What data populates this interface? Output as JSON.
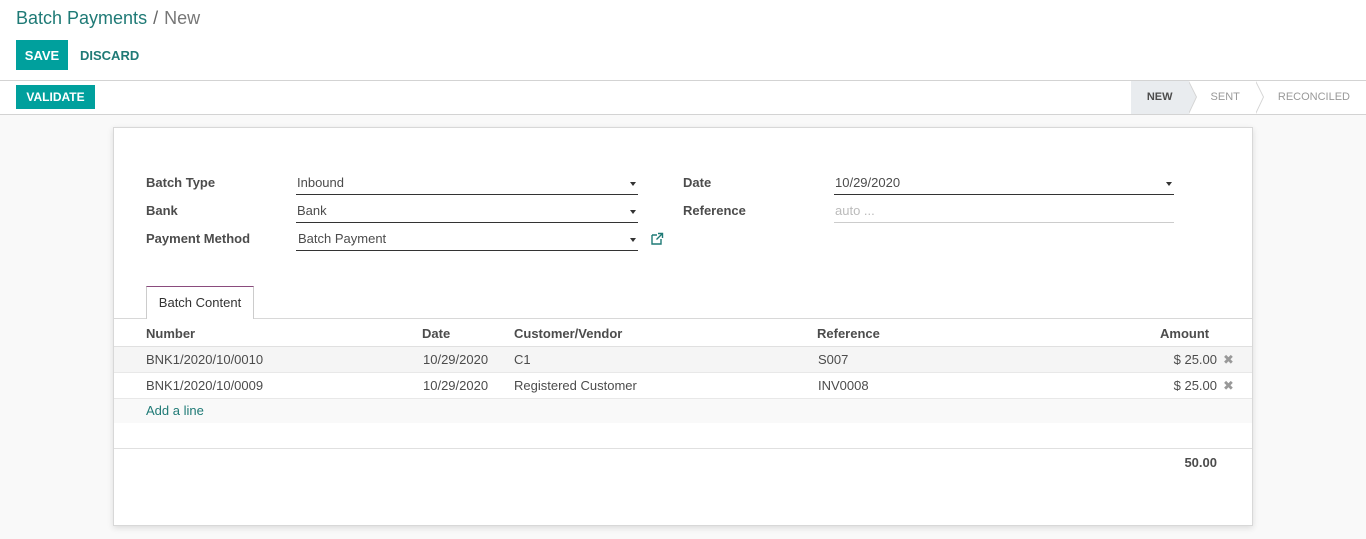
{
  "breadcrumb": {
    "parent": "Batch Payments",
    "separator": "/",
    "current": "New"
  },
  "toolbar": {
    "save_label": "SAVE",
    "discard_label": "DISCARD"
  },
  "statusbar": {
    "validate_label": "VALIDATE",
    "steps": [
      {
        "label": "NEW",
        "active": true
      },
      {
        "label": "SENT",
        "active": false
      },
      {
        "label": "RECONCILED",
        "active": false
      }
    ]
  },
  "form": {
    "batch_type": {
      "label": "Batch Type",
      "value": "Inbound"
    },
    "bank": {
      "label": "Bank",
      "value": "Bank"
    },
    "payment_method": {
      "label": "Payment Method",
      "value": "Batch Payment"
    },
    "date": {
      "label": "Date",
      "value": "10/29/2020"
    },
    "reference": {
      "label": "Reference",
      "placeholder": "auto ..."
    }
  },
  "tabs": [
    {
      "label": "Batch Content",
      "active": true
    }
  ],
  "table": {
    "headers": {
      "number": "Number",
      "date": "Date",
      "partner": "Customer/Vendor",
      "reference": "Reference",
      "amount": "Amount"
    },
    "rows": [
      {
        "number": "BNK1/2020/10/0010",
        "date": "10/29/2020",
        "partner": "C1",
        "reference": "S007",
        "amount": "$ 25.00"
      },
      {
        "number": "BNK1/2020/10/0009",
        "date": "10/29/2020",
        "partner": "Registered Customer",
        "reference": "INV0008",
        "amount": "$ 25.00"
      }
    ],
    "add_line": "Add a line",
    "total": "50.00"
  },
  "icons": {
    "dropdown": "caret-down-icon",
    "external": "external-link-icon",
    "delete": "delete-row-icon"
  },
  "colors": {
    "primary": "#00a09d",
    "link": "#1f7a76",
    "tab_accent": "#8a4b7d"
  }
}
